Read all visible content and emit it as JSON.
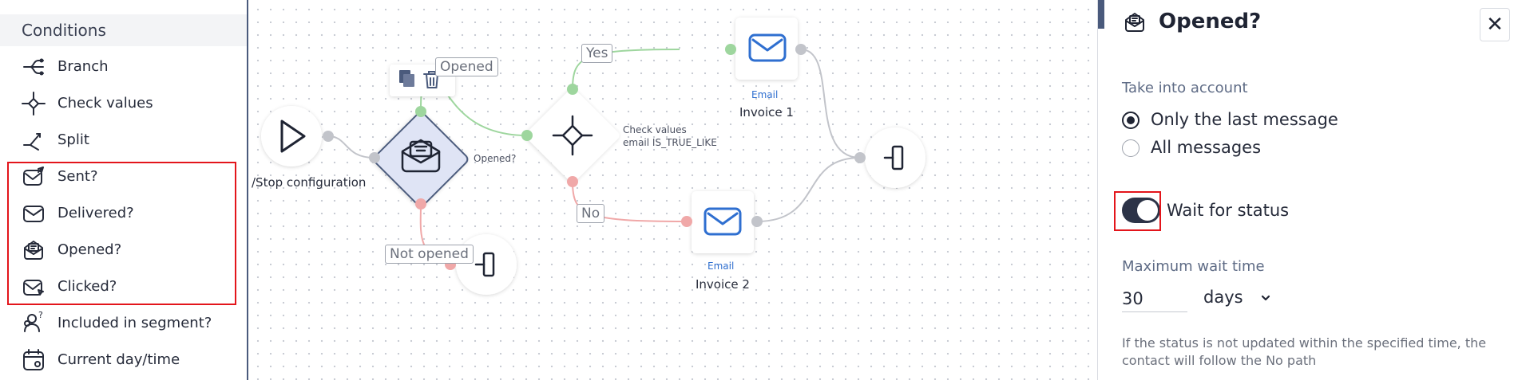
{
  "sidebar": {
    "header": "Conditions",
    "items": [
      {
        "label": "Branch",
        "icon": "branch-icon"
      },
      {
        "label": "Check values",
        "icon": "check-values-icon"
      },
      {
        "label": "Split",
        "icon": "split-icon"
      },
      {
        "label": "Sent?",
        "icon": "sent-icon"
      },
      {
        "label": "Delivered?",
        "icon": "delivered-icon"
      },
      {
        "label": "Opened?",
        "icon": "opened-icon"
      },
      {
        "label": "Clicked?",
        "icon": "clicked-icon"
      },
      {
        "label": "Included in segment?",
        "icon": "segment-icon"
      },
      {
        "label": "Current day/time",
        "icon": "calendar-icon"
      }
    ]
  },
  "canvas": {
    "start_label": "/Stop configuration",
    "opened_node_label": "Opened?",
    "edge_opened_label": "Opened",
    "edge_not_opened_label": "Not opened",
    "check_values_title": "Check values",
    "check_values_expr": "email IS_TRUE_LIKE",
    "edge_yes_label": "Yes",
    "edge_no_label": "No",
    "email1_type": "Email",
    "email1_name": "Invoice 1",
    "email2_type": "Email",
    "email2_name": "Invoice 2"
  },
  "panel": {
    "title": "Opened?",
    "take_into_account_label": "Take into account",
    "options": [
      {
        "label": "Only the last message",
        "checked": true
      },
      {
        "label": "All messages",
        "checked": false
      }
    ],
    "wait_for_status_label": "Wait for status",
    "wait_for_status_enabled": true,
    "max_wait_label": "Maximum wait time",
    "max_wait_value": "30",
    "max_wait_unit": "days",
    "help_text": "If the status is not updated within the specified time, the contact will follow the No path"
  },
  "colors": {
    "accent": "#4a5a7c",
    "yes_edge": "#8fd18f",
    "no_edge": "#f0a0a0",
    "email_icon": "#2f6fd0",
    "highlight": "#e3151b"
  }
}
